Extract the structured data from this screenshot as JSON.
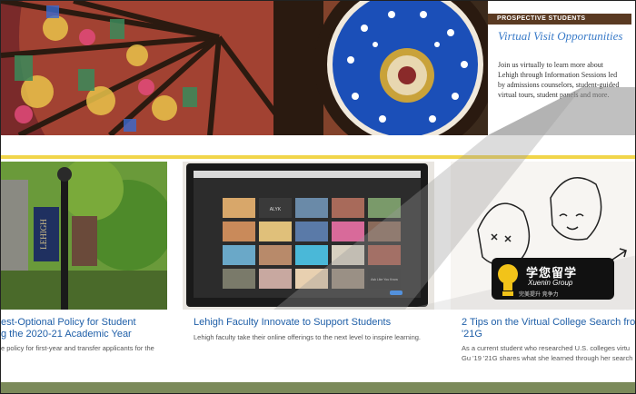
{
  "sidebar": {
    "badge": "PROSPECTIVE STUDENTS",
    "title": "Virtual Visit Opportunities",
    "text": "Join us virtually to learn more about Lehigh through Information Sessions led by admissions counselors, student-guided virtual tours, student panels and more."
  },
  "cards": [
    {
      "title_line1": "est-Optional Policy for Student",
      "title_line2": "g the 2020-21 Academic Year",
      "text_line1": "e policy for first-year and transfer applicants for the"
    },
    {
      "title_line1": "Lehigh Faculty Innovate to Support Students",
      "text_line1": "Lehigh faculty take their online offerings to the next level to inspire learning."
    },
    {
      "title_line1": "2 Tips on the Virtual College Search fro",
      "title_line2": "'21G",
      "text_line1": "As a current student who researched U.S. colleges virtu",
      "text_line2": "Gu '19 '21G shares what she learned through her search"
    }
  ],
  "banner": {
    "word": "LEHIGH"
  },
  "watermark": {
    "main": "学您留学",
    "sub": "Xuenin Group",
    "tag": "完美提升    竞争力"
  },
  "zoom": {
    "name1": "ALYK",
    "name2": "Ask Like You Know"
  }
}
